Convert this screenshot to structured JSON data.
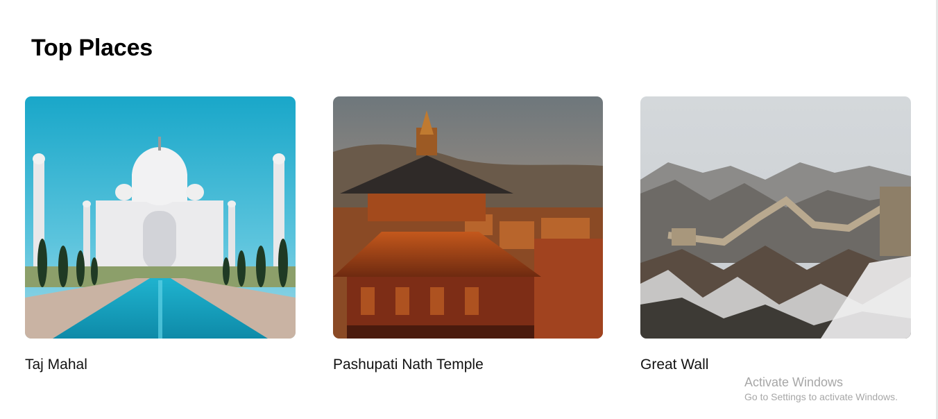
{
  "section": {
    "title": "Top Places"
  },
  "places": [
    {
      "name": "Taj Mahal"
    },
    {
      "name": "Pashupati Nath Temple"
    },
    {
      "name": "Great Wall"
    }
  ],
  "watermark": {
    "title": "Activate Windows",
    "subtitle": "Go to Settings to activate Windows."
  }
}
